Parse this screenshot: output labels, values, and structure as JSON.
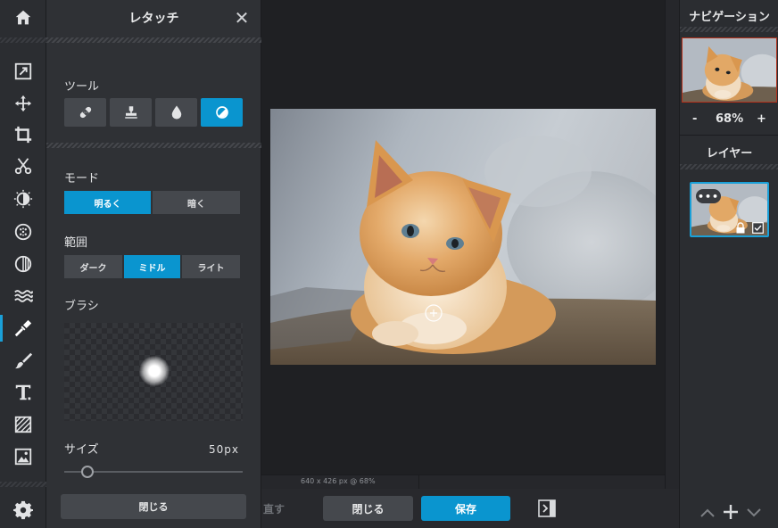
{
  "app": {
    "accent": "#0a95cf"
  },
  "toolbar": {
    "items": [
      "home-icon",
      "crop-export-icon",
      "move-icon",
      "crop-icon",
      "scissors-icon",
      "adjust-icon",
      "effects-icon",
      "filter-icon",
      "liquify-icon",
      "retouch-icon",
      "draw-icon",
      "text-icon",
      "pattern-icon",
      "image-icon",
      "settings-icon"
    ],
    "active": "retouch-icon"
  },
  "panel": {
    "title": "レタッチ",
    "close_label": "✕",
    "tools_label": "ツール",
    "tools": [
      "bandage-icon",
      "stamp-icon",
      "drop-icon",
      "dodge-burn-icon"
    ],
    "selected_tool": "dodge-burn-icon",
    "mode_label": "モード",
    "modes": [
      "明るく",
      "暗く"
    ],
    "selected_mode": "明るく",
    "range_label": "範囲",
    "ranges": [
      "ダーク",
      "ミドル",
      "ライト"
    ],
    "selected_range": "ミドル",
    "brush_label": "ブラシ",
    "size_label": "サイズ",
    "size_value": "50px",
    "size_slider_fraction": 0.13,
    "close_button": "閉じる"
  },
  "canvas": {
    "status": "640 x 426 px @ 68%"
  },
  "bottom": {
    "undo_label": "直す",
    "close_label": "閉じる",
    "save_label": "保存"
  },
  "right": {
    "navigation_title": "ナビゲーション",
    "zoom_minus": "-",
    "zoom_value": "68%",
    "zoom_plus": "+",
    "layers_title": "レイヤー",
    "layer_more": "•••"
  }
}
